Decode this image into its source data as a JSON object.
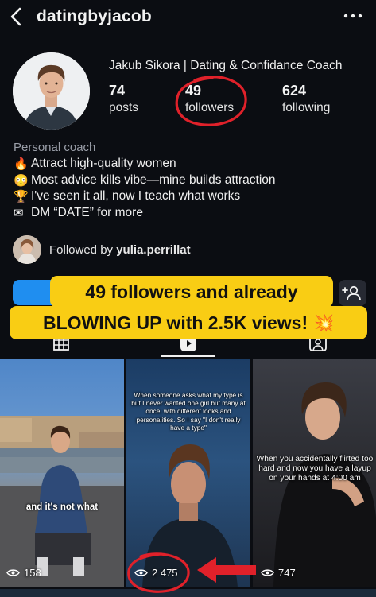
{
  "header": {
    "username": "datingbyjacob"
  },
  "profile": {
    "display_name": "Jakub Sikora | Dating & Confidance Coach",
    "stats": [
      {
        "value": "74",
        "label": "posts"
      },
      {
        "value": "49",
        "label": "followers"
      },
      {
        "value": "624",
        "label": "following"
      }
    ]
  },
  "bio": {
    "category": "Personal coach",
    "lines": [
      {
        "icon": "fire-icon",
        "glyph": "🔥",
        "text": "Attract high-quality women"
      },
      {
        "icon": "flushed-face-icon",
        "glyph": "😳",
        "text": "Most advice kills vibe—mine builds attraction"
      },
      {
        "icon": "trophy-icon",
        "glyph": "🏆",
        "text": "I've seen it all, now I teach what works"
      },
      {
        "icon": "envelope-icon",
        "glyph": "✉",
        "text": "DM “DATE” for more"
      }
    ]
  },
  "followed_by": {
    "prefix": "Followed by ",
    "user": "yulia.perrillat"
  },
  "banner": {
    "line1": "49 followers and already",
    "line2": "BLOWING UP with 2.5K views!",
    "emoji": "💥"
  },
  "reels": [
    {
      "caption": "and it's not what",
      "views": "158"
    },
    {
      "caption": "When someone asks what my type is but I never wanted one girl but many at once, with different looks and personalities. So I say \"I don't really have a type\"",
      "views": "2 475"
    },
    {
      "caption": "When you accidentally flirted too hard and now you have a layup on your hands at 4:00 am",
      "views": "747"
    }
  ],
  "colors": {
    "background": "#0b0d12",
    "accent_blue": "#1f8ef0",
    "highlight_red": "#e0212a",
    "banner_yellow": "#f9cd14"
  }
}
